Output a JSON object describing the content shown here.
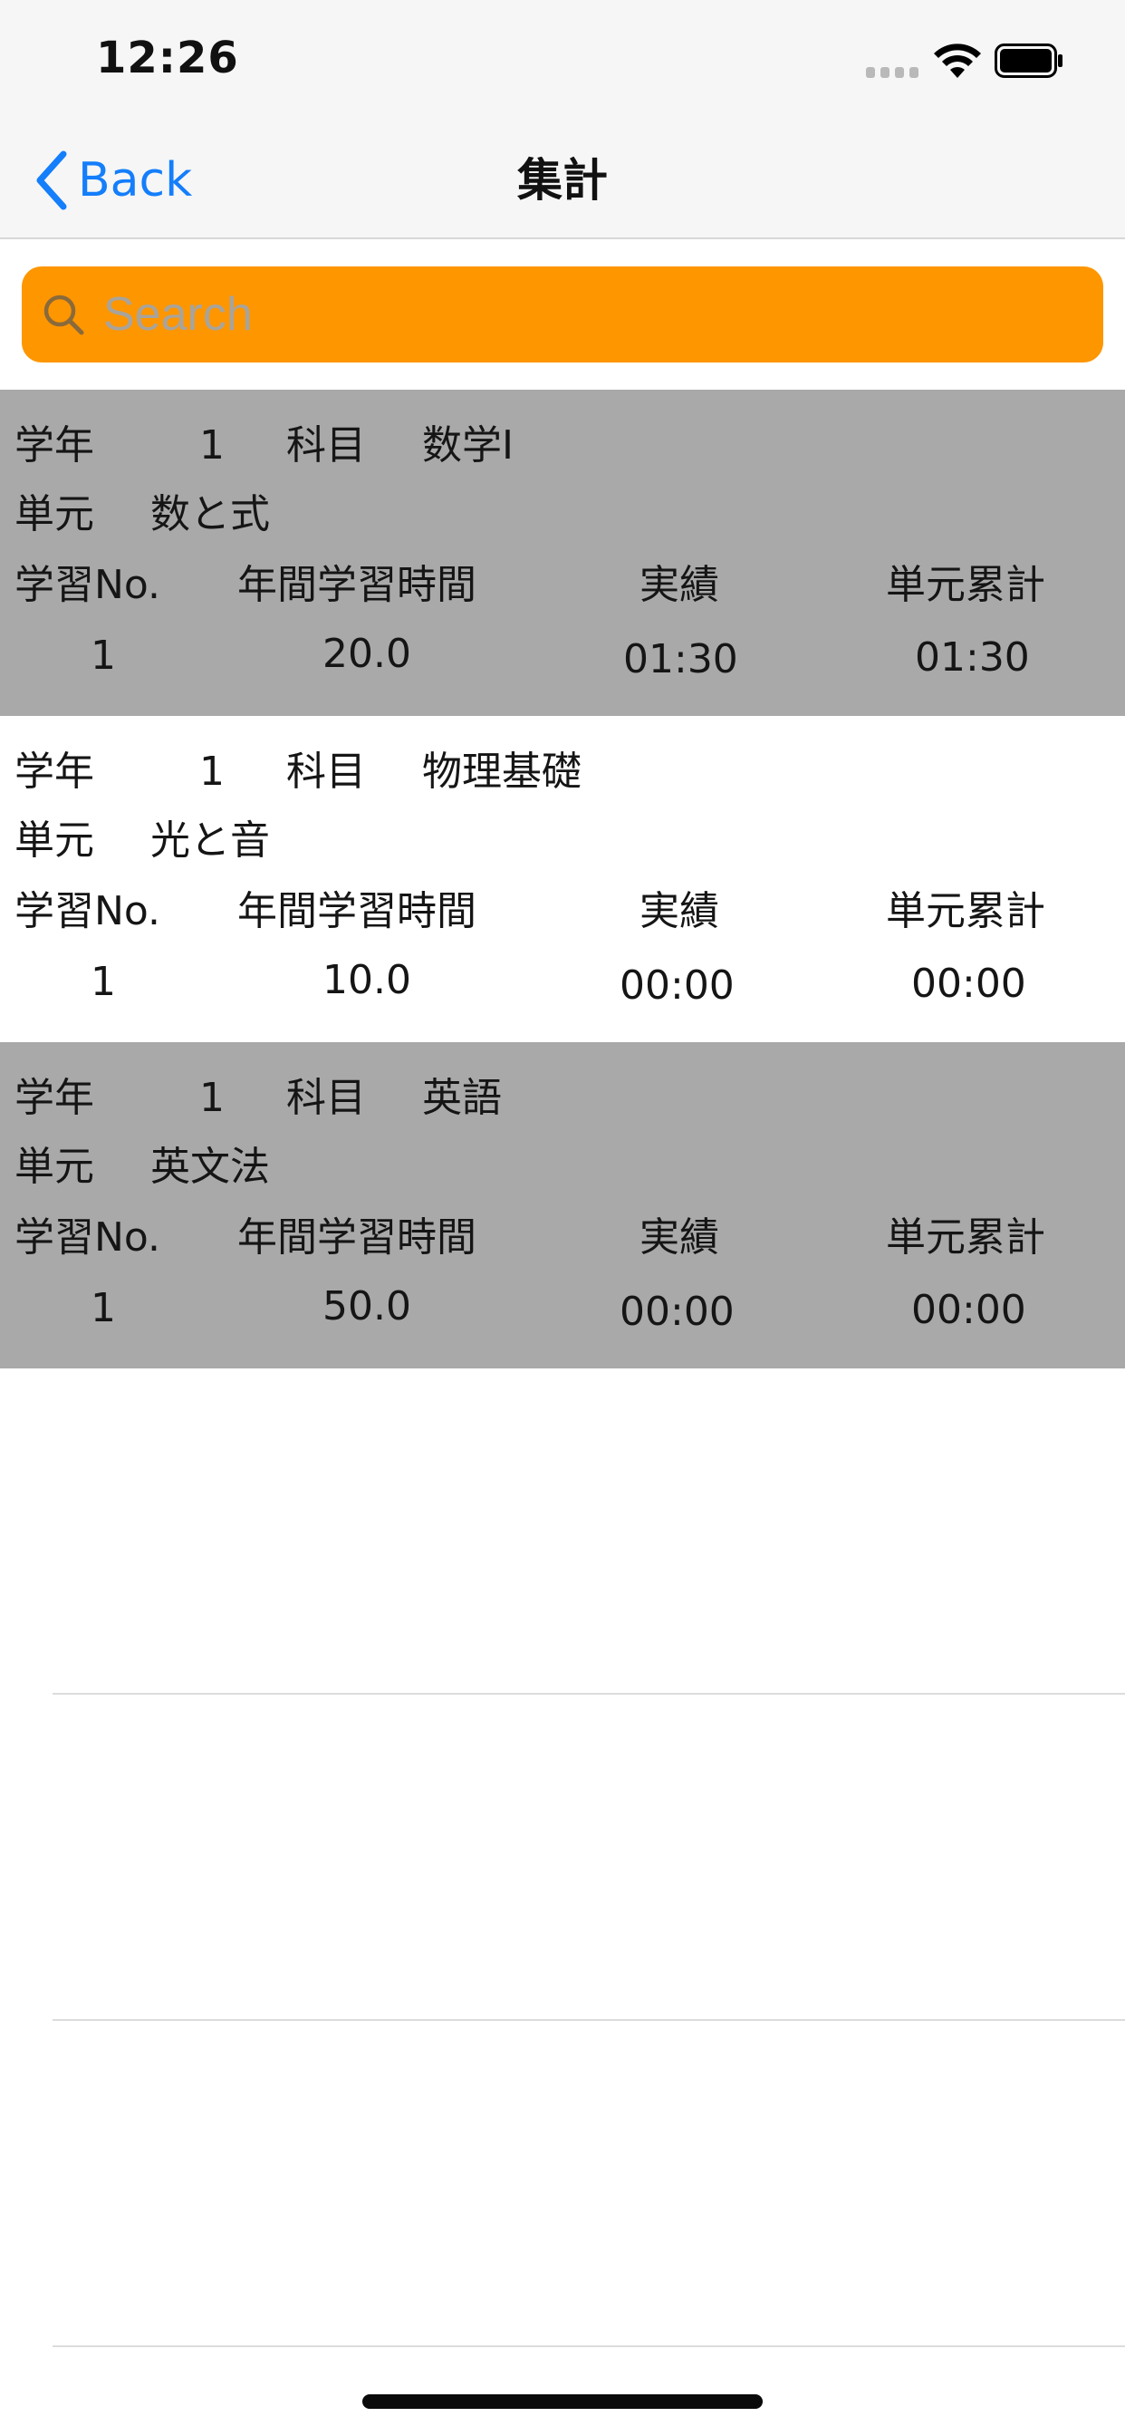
{
  "status_bar": {
    "time": "12:26",
    "icons": [
      "cellular-signal-icon",
      "wifi-icon",
      "battery-icon"
    ]
  },
  "nav": {
    "back_label": "Back",
    "title": "集計",
    "back_icon": "chevron-left-icon"
  },
  "search": {
    "placeholder": "Search",
    "value": "",
    "icon": "search-icon",
    "background_color": "#fe9600"
  },
  "labels": {
    "grade": "学年",
    "subject": "科目",
    "unit": "単元",
    "study_no": "学習No.",
    "annual_hours": "年間学習時間",
    "actual": "実績",
    "unit_total": "単元累計"
  },
  "rows": [
    {
      "grade": "1",
      "subject": "数学I",
      "unit": "数と式",
      "study_no": "1",
      "annual_hours": "20.0",
      "actual": "01:30",
      "unit_total": "01:30",
      "shaded": true
    },
    {
      "grade": "1",
      "subject": "物理基礎",
      "unit": "光と音",
      "study_no": "1",
      "annual_hours": "10.0",
      "actual": "00:00",
      "unit_total": "00:00",
      "shaded": false
    },
    {
      "grade": "1",
      "subject": "英語",
      "unit": "英文法",
      "study_no": "1",
      "annual_hours": "50.0",
      "actual": "00:00",
      "unit_total": "00:00",
      "shaded": true
    }
  ],
  "colors": {
    "accent": "#147efb",
    "row_shaded": "#a9a9a9",
    "bar_background": "#f6f6f6"
  }
}
